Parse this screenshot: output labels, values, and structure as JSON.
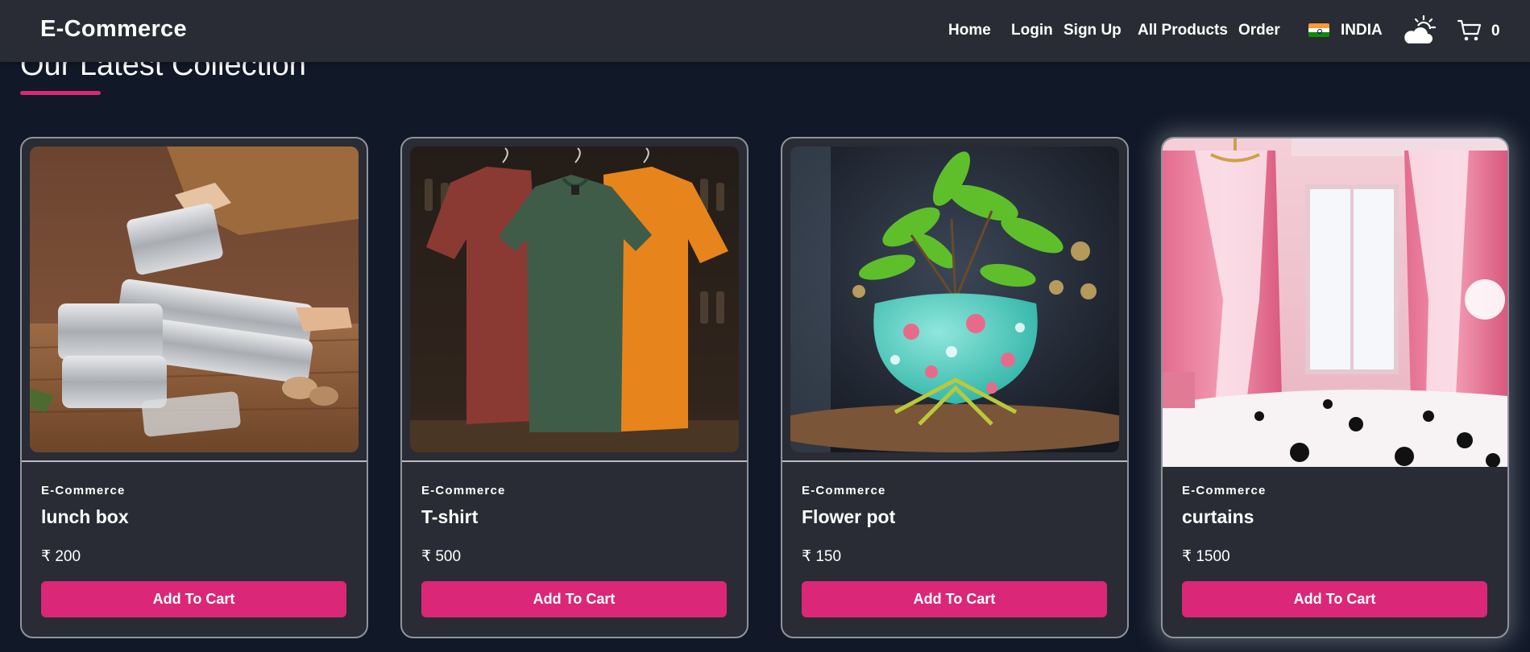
{
  "navbar": {
    "brand": "E-Commerce",
    "links": [
      {
        "label": "Home"
      },
      {
        "label": "Login"
      },
      {
        "label": "Sign Up"
      },
      {
        "label": "All Products"
      },
      {
        "label": "Order"
      }
    ],
    "country": "INDIA",
    "cart_count": "0",
    "icons": [
      "india-flag-icon",
      "weather-icon",
      "cart-icon"
    ]
  },
  "section": {
    "title": "Our Latest Collection"
  },
  "products": [
    {
      "brand": "E-Commerce",
      "name": "lunch box",
      "price": "₹ 200",
      "button": "Add To Cart",
      "image": "steel lunch box containers"
    },
    {
      "brand": "E-Commerce",
      "name": "T-shirt",
      "price": "₹ 500",
      "button": "Add To Cart",
      "image": "three t-shirts on hangers"
    },
    {
      "brand": "E-Commerce",
      "name": "Flower pot",
      "price": "₹ 150",
      "button": "Add To Cart",
      "image": "floral ceramic pot with plant"
    },
    {
      "brand": "E-Commerce",
      "name": "curtains",
      "price": "₹ 1500",
      "button": "Add To Cart",
      "image": "pink curtains in bedroom"
    }
  ],
  "colors": {
    "background": "#111827",
    "navbar": "#292c34",
    "card": "#292c34",
    "accent": "#db2777"
  }
}
